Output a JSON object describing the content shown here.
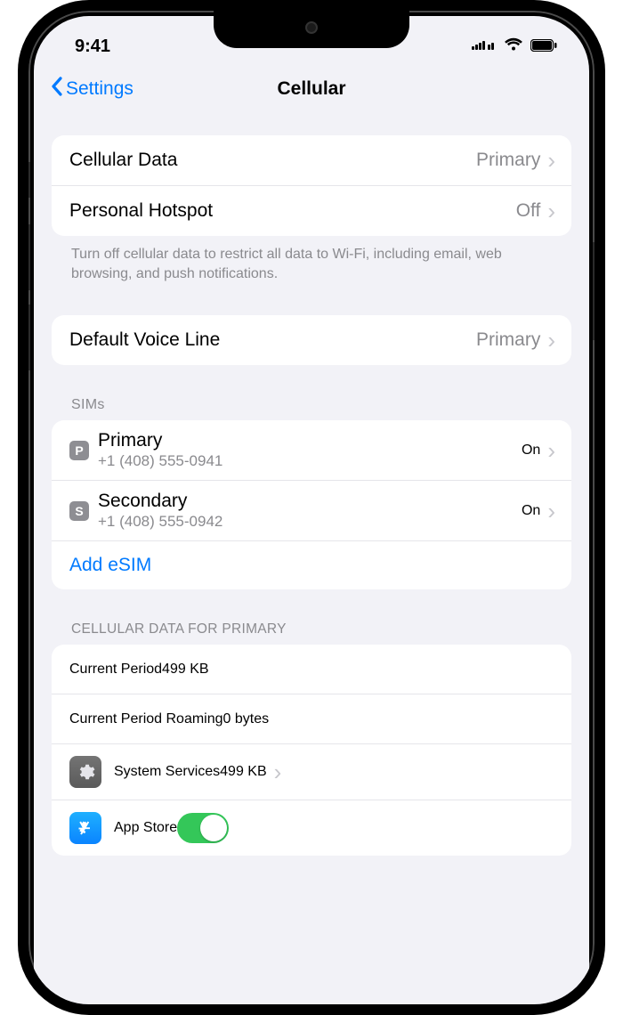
{
  "statusBar": {
    "time": "9:41"
  },
  "nav": {
    "back": "Settings",
    "title": "Cellular"
  },
  "cellularData": {
    "label": "Cellular Data",
    "value": "Primary"
  },
  "hotspot": {
    "label": "Personal Hotspot",
    "value": "Off"
  },
  "dataFooter": "Turn off cellular data to restrict all data to Wi-Fi, including email, web browsing, and push notifications.",
  "voiceLine": {
    "label": "Default Voice Line",
    "value": "Primary"
  },
  "simsHeader": "SIMs",
  "sims": [
    {
      "badge": "P",
      "name": "Primary",
      "phone": "+1 (408) 555-0941",
      "status": "On"
    },
    {
      "badge": "S",
      "name": "Secondary",
      "phone": "+1 (408) 555-0942",
      "status": "On"
    }
  ],
  "addEsim": "Add eSIM",
  "dataHeader": "CELLULAR DATA FOR PRIMARY",
  "currentPeriod": {
    "label": "Current Period",
    "value": "499 KB"
  },
  "currentRoaming": {
    "label": "Current Period Roaming",
    "value": "0 bytes"
  },
  "systemServices": {
    "label": "System Services",
    "value": "499 KB"
  },
  "appStore": {
    "label": "App Store"
  }
}
